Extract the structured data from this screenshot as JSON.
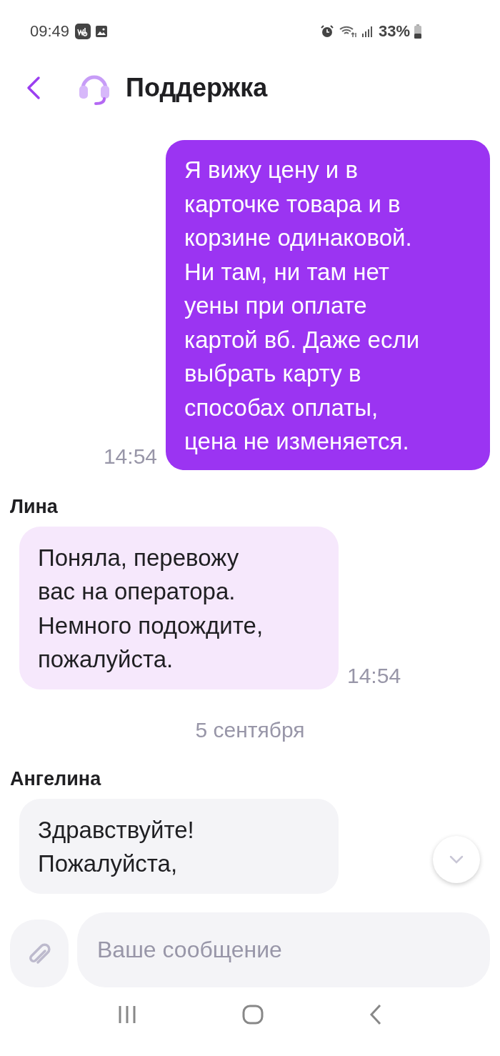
{
  "status_bar": {
    "time": "09:49",
    "battery": "33%"
  },
  "header": {
    "title": "Поддержка"
  },
  "messages": [
    {
      "kind": "outgoing",
      "text": "Я вижу цену и в\nкарточке товара и в\nкорзине одинаковой.\nНи там, ни там нет\nуены при оплате\nкартой вб. Даже если\nвыбрать карту в\nспособах оплаты,\nцена не изменяется.",
      "time": "14:54"
    },
    {
      "kind": "incoming",
      "author": "Лина",
      "text": "Поняла, перевожу\nвас на оператора.\nНемного подождите,\nпожалуйста.",
      "time": "14:54",
      "color": "#f6e8fc"
    },
    {
      "kind": "date",
      "text": "5 сентября"
    },
    {
      "kind": "incoming",
      "author": "Ангелина",
      "text": "Здравствуйте!\nПожалуйста,",
      "color": "#f4f4f7"
    }
  ],
  "composer": {
    "placeholder": "Ваше сообщение"
  }
}
